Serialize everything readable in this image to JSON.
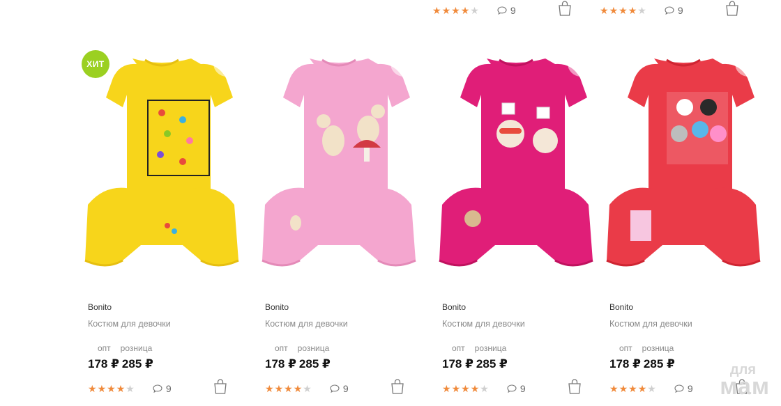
{
  "top_row": [
    {
      "rating": 4,
      "comments": "9"
    },
    {
      "rating": 4,
      "comments": "9"
    }
  ],
  "labels": {
    "hit": "ХИТ",
    "opt": "опт",
    "retail": "розница"
  },
  "products": [
    {
      "brand": "Bonito",
      "name": "Костюм для девочки",
      "price_opt": "178 ₽",
      "price_retail": "285 ₽",
      "rating": 4,
      "comments": "9",
      "hit": true,
      "color": "#f7d51b"
    },
    {
      "brand": "Bonito",
      "name": "Костюм для девочки",
      "price_opt": "178 ₽",
      "price_retail": "285 ₽",
      "rating": 4,
      "comments": "9",
      "hit": false,
      "color": "#f4a6cf"
    },
    {
      "brand": "Bonito",
      "name": "Костюм для девочки",
      "price_opt": "178 ₽",
      "price_retail": "285 ₽",
      "rating": 4,
      "comments": "9",
      "hit": false,
      "color": "#e01e78"
    },
    {
      "brand": "Bonito",
      "name": "Костюм для девочки",
      "price_opt": "178 ₽",
      "price_retail": "285 ₽",
      "rating": 4,
      "comments": "9",
      "hit": false,
      "color": "#ea3b48"
    }
  ],
  "watermark": {
    "line1": "для",
    "line2": "мам"
  },
  "colors": {
    "star": "#f08a3b",
    "star_off": "#cfcfcf",
    "hit_badge": "#9bd021"
  },
  "icons": {
    "comment": "comment-icon",
    "bag": "shopping-bag-icon",
    "heart": "heart-icon",
    "star": "star-icon"
  }
}
